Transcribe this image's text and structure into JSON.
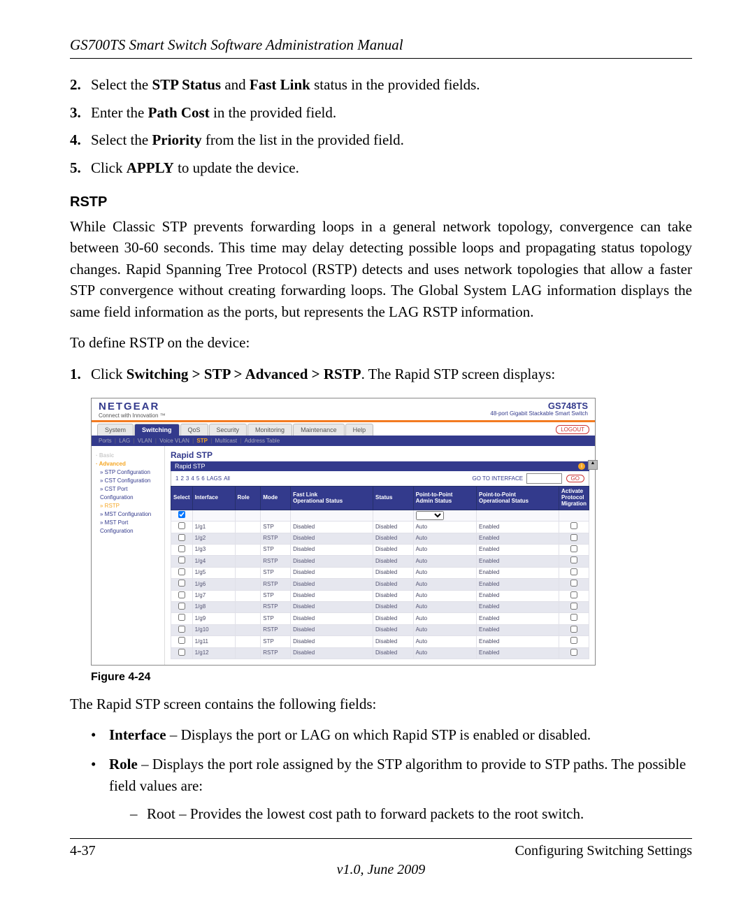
{
  "header": {
    "title": "GS700TS Smart Switch Software Administration Manual"
  },
  "steps": [
    {
      "n": "2.",
      "html": "Select the <b>STP Status</b> and <b>Fast Link</b> status in the provided fields."
    },
    {
      "n": "3.",
      "html": "Enter the <b>Path Cost</b> in the provided field."
    },
    {
      "n": "4.",
      "html": "Select the <b>Priority</b> from the list in the provided field."
    },
    {
      "n": "5.",
      "html": "Click <b>APPLY</b> to update the device."
    }
  ],
  "section": {
    "heading": "RSTP"
  },
  "para1": "While Classic STP prevents forwarding loops in a general network topology, convergence can take between 30-60 seconds. This time may delay detecting possible loops and propagating status topology changes. Rapid Spanning Tree Protocol (RSTP) detects and uses network topologies that allow a faster STP convergence without creating forwarding loops. The Global System LAG information displays the same field information as the ports, but represents the LAG RSTP information.",
  "para2": "To define RSTP on the device:",
  "step1": {
    "n": "1.",
    "html": "Click <b>Switching > STP > Advanced > RSTP</b>. The Rapid STP screen displays:"
  },
  "shot": {
    "brand": "NETGEAR",
    "tag": "Connect with Innovation ™",
    "model": "GS748TS",
    "model_desc": "48-port Gigabit Stackable Smart Switch",
    "tabs": [
      "System",
      "Switching",
      "QoS",
      "Security",
      "Monitoring",
      "Maintenance",
      "Help"
    ],
    "logout": "LOGOUT",
    "subtabs": [
      "Ports",
      "LAG",
      "VLAN",
      "Voice VLAN",
      "STP",
      "Multicast",
      "Address Table"
    ],
    "subtab_active": "STP",
    "leftnav": {
      "groups": [
        {
          "label": "Basic",
          "cls": "grp"
        },
        {
          "label": "Advanced",
          "cls": "curgrp"
        }
      ],
      "links": [
        "STP Configuration",
        "CST Configuration",
        "CST Port Configuration",
        "RSTP",
        "MST Configuration",
        "MST Port Configuration"
      ],
      "current": "RSTP"
    },
    "panel_title": "Rapid STP",
    "panel_sub": "Rapid STP",
    "pager": {
      "nums": [
        "1",
        "2",
        "3",
        "4",
        "5",
        "6"
      ],
      "lags": "LAGS",
      "all": "All",
      "goto_label": "GO TO INTERFACE",
      "go": "GO"
    },
    "columns": [
      "Select",
      "Interface",
      "Role",
      "Mode",
      "Fast Link Operational Status",
      "Status",
      "Point-to-Point Admin Status",
      "Point-to-Point Operational Status",
      "Activate Protocol Migration"
    ],
    "rows": [
      {
        "if": "1/g1",
        "mode": "STP",
        "fast": "Disabled",
        "stat": "Disabled",
        "adm": "Auto",
        "op": "Enabled",
        "alt": false
      },
      {
        "if": "1/g2",
        "mode": "RSTP",
        "fast": "Disabled",
        "stat": "Disabled",
        "adm": "Auto",
        "op": "Enabled",
        "alt": true
      },
      {
        "if": "1/g3",
        "mode": "STP",
        "fast": "Disabled",
        "stat": "Disabled",
        "adm": "Auto",
        "op": "Enabled",
        "alt": false
      },
      {
        "if": "1/g4",
        "mode": "RSTP",
        "fast": "Disabled",
        "stat": "Disabled",
        "adm": "Auto",
        "op": "Enabled",
        "alt": true
      },
      {
        "if": "1/g5",
        "mode": "STP",
        "fast": "Disabled",
        "stat": "Disabled",
        "adm": "Auto",
        "op": "Enabled",
        "alt": false
      },
      {
        "if": "1/g6",
        "mode": "RSTP",
        "fast": "Disabled",
        "stat": "Disabled",
        "adm": "Auto",
        "op": "Enabled",
        "alt": true
      },
      {
        "if": "1/g7",
        "mode": "STP",
        "fast": "Disabled",
        "stat": "Disabled",
        "adm": "Auto",
        "op": "Enabled",
        "alt": false
      },
      {
        "if": "1/g8",
        "mode": "RSTP",
        "fast": "Disabled",
        "stat": "Disabled",
        "adm": "Auto",
        "op": "Enabled",
        "alt": true
      },
      {
        "if": "1/g9",
        "mode": "STP",
        "fast": "Disabled",
        "stat": "Disabled",
        "adm": "Auto",
        "op": "Enabled",
        "alt": false
      },
      {
        "if": "1/g10",
        "mode": "RSTP",
        "fast": "Disabled",
        "stat": "Disabled",
        "adm": "Auto",
        "op": "Enabled",
        "alt": true
      },
      {
        "if": "1/g11",
        "mode": "STP",
        "fast": "Disabled",
        "stat": "Disabled",
        "adm": "Auto",
        "op": "Enabled",
        "alt": false
      },
      {
        "if": "1/g12",
        "mode": "RSTP",
        "fast": "Disabled",
        "stat": "Disabled",
        "adm": "Auto",
        "op": "Enabled",
        "alt": true
      }
    ]
  },
  "figcap": "Figure 4-24",
  "para3": "The Rapid STP screen contains the following fields:",
  "bullets": [
    {
      "html": "<b>Interface</b> – Displays the port or LAG on which Rapid STP is enabled or disabled."
    },
    {
      "html": "<b>Role</b> – Displays the port role assigned by the STP algorithm to provide to STP paths. The possible field values are:",
      "sub": [
        "Root – Provides the lowest cost path to forward packets to the root switch."
      ]
    }
  ],
  "footer": {
    "left": "4-37",
    "right": "Configuring Switching Settings",
    "version": "v1.0, June 2009"
  }
}
